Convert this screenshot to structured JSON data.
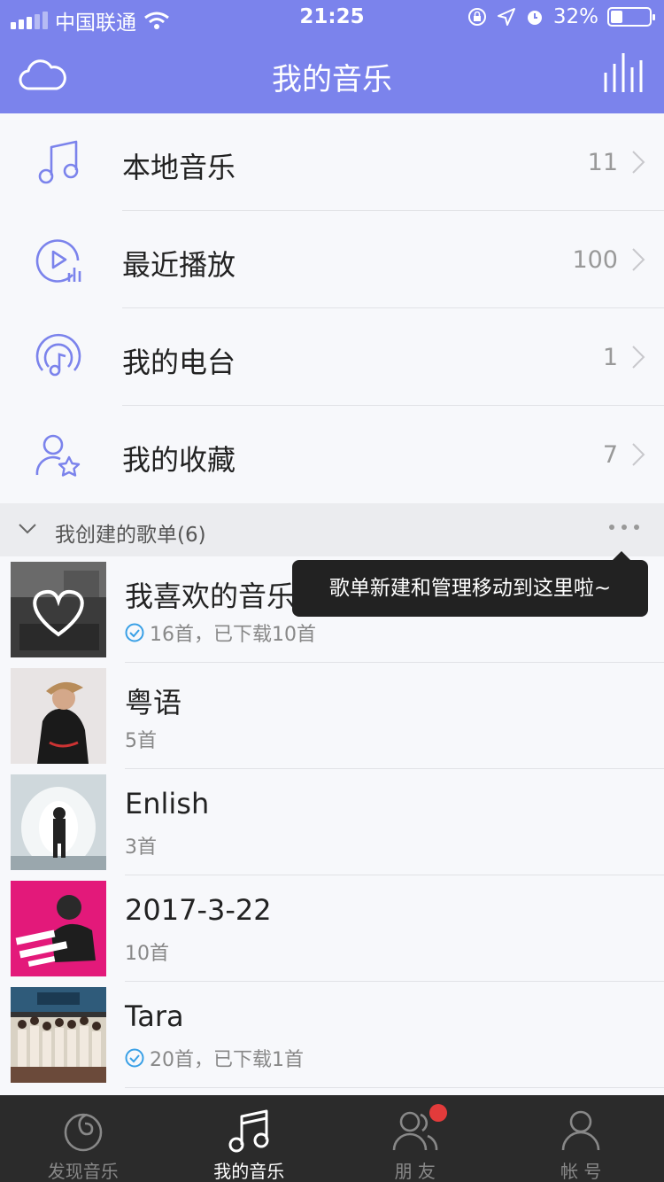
{
  "status_bar": {
    "carrier": "中国联通",
    "time": "21:25",
    "battery": "32%",
    "battery_level": 0.32
  },
  "header": {
    "title": "我的音乐",
    "left_icon": "cloud-icon",
    "right_icon": "equalizer-icon"
  },
  "menu": [
    {
      "label": "本地音乐",
      "count": "11",
      "icon": "music-note-icon"
    },
    {
      "label": "最近播放",
      "count": "100",
      "icon": "recent-play-icon"
    },
    {
      "label": "我的电台",
      "count": "1",
      "icon": "radio-icon"
    },
    {
      "label": "我的收藏",
      "count": "7",
      "icon": "user-star-icon"
    }
  ],
  "section": {
    "title": "我创建的歌单(6)"
  },
  "tooltip": {
    "text": "歌单新建和管理移动到这里啦~"
  },
  "playlists": [
    {
      "name": "我喜欢的音乐",
      "sub": "16首，已下载10首",
      "downloaded": true
    },
    {
      "name": "粤语",
      "sub": "5首",
      "downloaded": false
    },
    {
      "name": "Enlish",
      "sub": "3首",
      "downloaded": false
    },
    {
      "name": "2017-3-22",
      "sub": "10首",
      "downloaded": false
    },
    {
      "name": "Tara",
      "sub": "20首，已下载1首",
      "downloaded": true
    }
  ],
  "tabs": [
    {
      "label": "发现音乐",
      "icon": "discover-music-icon",
      "active": false
    },
    {
      "label": "我的音乐",
      "icon": "my-music-icon",
      "active": true
    },
    {
      "label": "朋 友",
      "icon": "friends-icon",
      "active": false
    },
    {
      "label": "帐 号",
      "icon": "account-icon",
      "active": false
    }
  ],
  "colors": {
    "accent": "#7b83ec",
    "tabbar": "#2b2b2b",
    "badge": "#e23b3b",
    "download_check": "#39a0e6"
  }
}
